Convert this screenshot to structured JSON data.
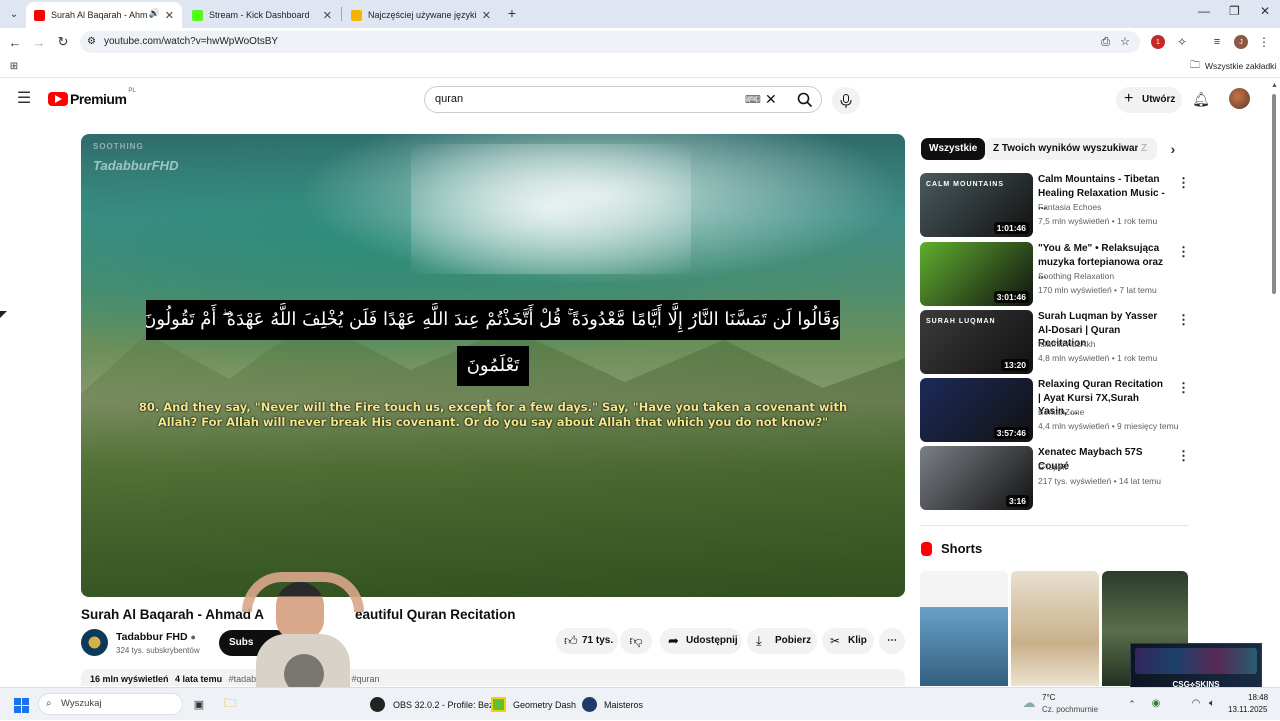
{
  "browser": {
    "tabs": [
      {
        "title": "Surah Al Baqarah - Ahmad Al Nufais",
        "active": true,
        "favicon_color": "#ff0000"
      },
      {
        "title": "Stream - Kick Dashboard",
        "active": false,
        "favicon_color": "#53fc18"
      },
      {
        "title": "Najczęściej używane języki świata",
        "active": false,
        "favicon_color": "#f5b400"
      }
    ],
    "url": "youtube.com/watch?v=hwWpWoOtsBY",
    "bookmarks_label": "Wszystkie zakładki"
  },
  "youtube": {
    "logo_text": "Premium",
    "logo_region": "PL",
    "search_value": "quran",
    "create_label": "Utwórz",
    "video": {
      "watermark_top": "SOOTHING",
      "watermark_brand": "TadabburFHD",
      "arabic_line1": "وَقَالُوا لَن تَمَسَّنَا النَّارُ إِلَّا أَيَّامًا مَّعْدُودَةً ۚ قُلْ أَتَّخَذْتُمْ عِندَ اللَّهِ عَهْدًا فَلَن يُخْلِفَ اللَّهُ عَهْدَهُ ۖ أَمْ تَقُولُونَ عَلَى اللَّهِ مَا لَا",
      "arabic_line2": "تَعْلَمُونَ ٨٠",
      "english_subtitle": "80.  And they say, \"Never will the Fire touch us, except for a few days.\" Say, \"Have you taken a covenant with Allah? For Allah will never break His covenant. Or do you say about Allah that which you do not know?\"",
      "title_left": "Surah Al Baqarah - Ahmad A",
      "title_right": "eautiful Quran Recitation",
      "channel_name": "Tadabbur FHD",
      "subscribers": "324 tys. subskrybentów",
      "subscribe_label": "Subs",
      "likes": "71 tys.",
      "share_label": "Udostępnij",
      "download_label": "Pobierz",
      "clip_label": "Klip",
      "views": "16 mln wyświetleń",
      "age": "4 lata temu",
      "tags_left": "#tadabb",
      "tags_right": "an #quran"
    },
    "chips": [
      "Wszystkie",
      "Z Twoich wyników wyszukiwania",
      "Z"
    ],
    "recommendations": [
      {
        "title": "Calm Mountains - Tibetan Healing Relaxation Music - ...",
        "channel": "Fantasia Echoes",
        "meta": "7,5 mln wyświetleń • 1 rok temu",
        "duration": "1:01:46",
        "thumb_color": "#4a5a5e",
        "thumb_text": "CALM MOUNTAINS"
      },
      {
        "title": "\"You & Me\" • Relaksująca muzyka fortepianowa oraz ...",
        "channel": "Soothing Relaxation",
        "meta": "170 mln wyświetleń • 7 lat temu",
        "duration": "3:01:46",
        "thumb_color": "#5fae2e",
        "thumb_text": ""
      },
      {
        "title": "Surah Luqman by Yasser Al-Dosari | Quran Recitation",
        "channel": "IslamicVidsAkh",
        "meta": "4,8 mln wyświetleń • 1 rok temu",
        "duration": "13:20",
        "thumb_color": "#3b3b3b",
        "thumb_text": "SURAH LUQMAN"
      },
      {
        "title": "Relaxing Quran Recitation | Ayat Kursi 7X,Surah Yasin, ...",
        "channel": "BerkahZone",
        "meta": "4,4 mln wyświetleń • 9 miesięcy temu",
        "duration": "3:57:46",
        "thumb_color": "#1d2a5a",
        "thumb_text": ""
      },
      {
        "title": "Xenatec Maybach 57S Coupé",
        "channel": "GTspirit",
        "meta": "217 tys. wyświetleń • 14 lat temu",
        "duration": "3:16",
        "thumb_color": "#7a7f86",
        "thumb_text": ""
      }
    ],
    "shorts_label": "Shorts"
  },
  "taskbar": {
    "search_placeholder": "Wyszukaj",
    "apps": [
      {
        "label": "OBS 32.0.2 - Profile: Bez"
      },
      {
        "label": "Geometry Dash"
      },
      {
        "label": "Maisteros"
      }
    ],
    "weather_temp": "7°C",
    "weather_desc": "Cz. pochmurnie",
    "time": "18:48",
    "date": "13.11.2025"
  },
  "overlay": {
    "csg_label": "CSG⟡SKINS"
  },
  "colors": {
    "youtube_red": "#ff0000",
    "accent_blue": "#065fd4"
  }
}
